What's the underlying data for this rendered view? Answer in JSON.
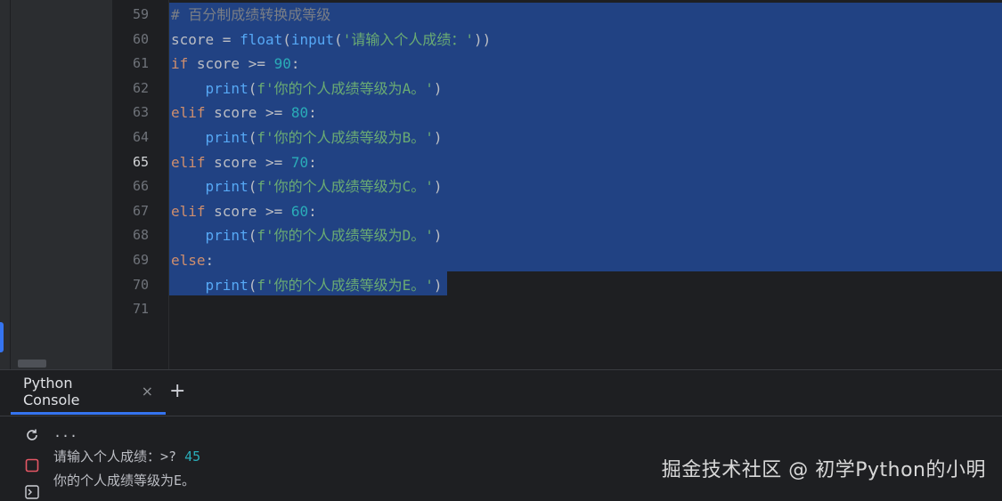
{
  "editor": {
    "lines": [
      {
        "num": "59",
        "tokens": [
          {
            "t": "# 百分制成绩转换成等级",
            "c": "cmt"
          }
        ]
      },
      {
        "num": "60",
        "tokens": [
          {
            "t": "score = ",
            "c": "plain"
          },
          {
            "t": "float",
            "c": "fn"
          },
          {
            "t": "(",
            "c": "plain"
          },
          {
            "t": "input",
            "c": "fn"
          },
          {
            "t": "(",
            "c": "plain"
          },
          {
            "t": "'请输入个人成绩：'",
            "c": "str"
          },
          {
            "t": "))",
            "c": "plain"
          }
        ]
      },
      {
        "num": "61",
        "tokens": [
          {
            "t": "if",
            "c": "kw"
          },
          {
            "t": " score >= ",
            "c": "plain"
          },
          {
            "t": "90",
            "c": "num"
          },
          {
            "t": ":",
            "c": "plain"
          }
        ]
      },
      {
        "num": "62",
        "tokens": [
          {
            "t": "    ",
            "c": "plain"
          },
          {
            "t": "print",
            "c": "fn"
          },
          {
            "t": "(",
            "c": "plain"
          },
          {
            "t": "f'你的个人成绩等级为A。'",
            "c": "str"
          },
          {
            "t": ")",
            "c": "plain"
          }
        ]
      },
      {
        "num": "63",
        "tokens": [
          {
            "t": "elif",
            "c": "kw"
          },
          {
            "t": " score >= ",
            "c": "plain"
          },
          {
            "t": "80",
            "c": "num"
          },
          {
            "t": ":",
            "c": "plain"
          }
        ]
      },
      {
        "num": "64",
        "tokens": [
          {
            "t": "    ",
            "c": "plain"
          },
          {
            "t": "print",
            "c": "fn"
          },
          {
            "t": "(",
            "c": "plain"
          },
          {
            "t": "f'你的个人成绩等级为B。'",
            "c": "str"
          },
          {
            "t": ")",
            "c": "plain"
          }
        ]
      },
      {
        "num": "65",
        "tokens": [
          {
            "t": "elif",
            "c": "kw"
          },
          {
            "t": " score >= ",
            "c": "plain"
          },
          {
            "t": "70",
            "c": "num"
          },
          {
            "t": ":",
            "c": "plain"
          }
        ]
      },
      {
        "num": "66",
        "tokens": [
          {
            "t": "    ",
            "c": "plain"
          },
          {
            "t": "print",
            "c": "fn"
          },
          {
            "t": "(",
            "c": "plain"
          },
          {
            "t": "f'你的个人成绩等级为C。'",
            "c": "str"
          },
          {
            "t": ")",
            "c": "plain"
          }
        ]
      },
      {
        "num": "67",
        "tokens": [
          {
            "t": "elif",
            "c": "kw"
          },
          {
            "t": " score >= ",
            "c": "plain"
          },
          {
            "t": "60",
            "c": "num"
          },
          {
            "t": ":",
            "c": "plain"
          }
        ]
      },
      {
        "num": "68",
        "tokens": [
          {
            "t": "    ",
            "c": "plain"
          },
          {
            "t": "print",
            "c": "fn"
          },
          {
            "t": "(",
            "c": "plain"
          },
          {
            "t": "f'你的个人成绩等级为D。'",
            "c": "str"
          },
          {
            "t": ")",
            "c": "plain"
          }
        ]
      },
      {
        "num": "69",
        "tokens": [
          {
            "t": "else",
            "c": "kw"
          },
          {
            "t": ":",
            "c": "plain"
          }
        ]
      },
      {
        "num": "70",
        "tokens": [
          {
            "t": "    ",
            "c": "plain"
          },
          {
            "t": "print",
            "c": "fn"
          },
          {
            "t": "(",
            "c": "plain"
          },
          {
            "t": "f'你的个人成绩等级为E。'",
            "c": "str"
          },
          {
            "t": ")",
            "c": "plain"
          }
        ]
      },
      {
        "num": "71",
        "tokens": []
      }
    ],
    "current_line": "65"
  },
  "console": {
    "tab_label": "Python Console",
    "close_glyph": "×",
    "add_glyph": "+",
    "output": [
      {
        "tokens": [
          {
            "t": "...",
            "c": "plain"
          }
        ]
      },
      {
        "tokens": [
          {
            "t": "请输入个人成绩：>? ",
            "c": "plain"
          },
          {
            "t": "45",
            "c": "num"
          }
        ]
      },
      {
        "tokens": [
          {
            "t": "你的个人成绩等级为E。",
            "c": "plain"
          }
        ]
      }
    ],
    "toolbar_icons": [
      "rerun-icon",
      "stop-icon",
      "console-prompt-icon"
    ]
  },
  "watermark": "掘金技术社区 @ 初学Python的小明",
  "colors": {
    "selection": "#214283",
    "keyword": "#cf8e6d",
    "function": "#56a8f5",
    "string": "#6aab73",
    "number": "#2aacb8",
    "comment": "#7a7e85",
    "accent": "#3574f0"
  }
}
